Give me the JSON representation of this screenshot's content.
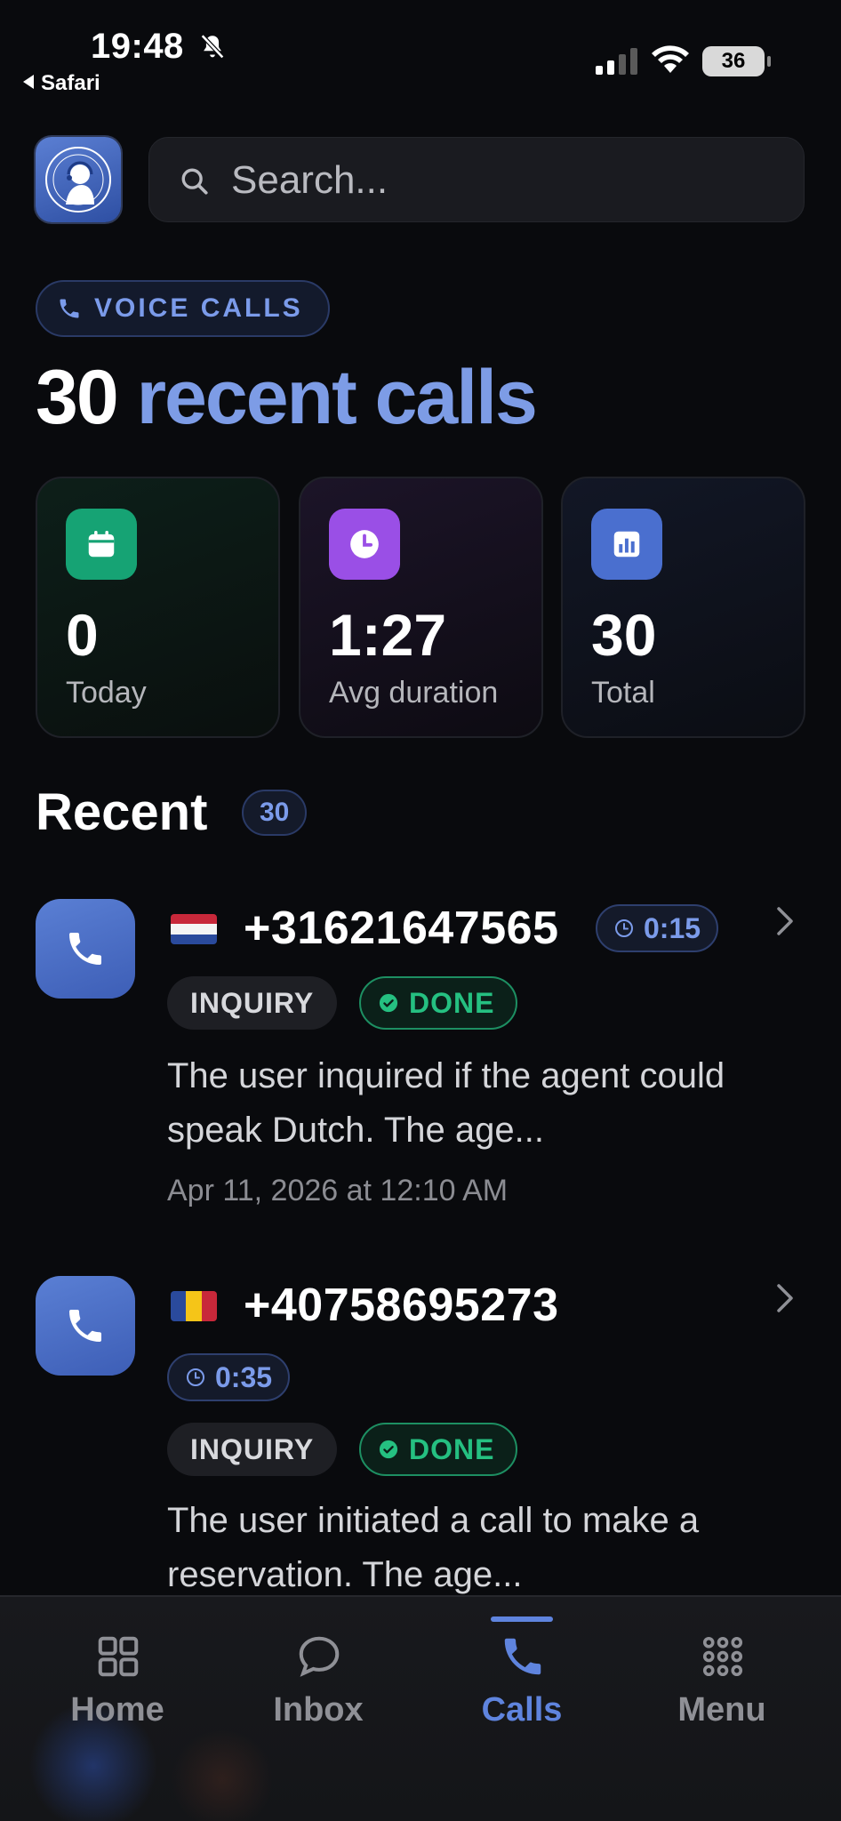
{
  "status_bar": {
    "time": "19:48",
    "back_app": "Safari",
    "battery": "36"
  },
  "search": {
    "placeholder": "Search..."
  },
  "section_pill": "VOICE CALLS",
  "headline": {
    "count": "30",
    "text": "recent calls"
  },
  "stats": [
    {
      "value": "0",
      "label": "Today",
      "icon": "calendar-icon",
      "color": "#16a374"
    },
    {
      "value": "1:27",
      "label": "Avg duration",
      "icon": "clock-icon",
      "color": "#9a4fe6"
    },
    {
      "value": "30",
      "label": "Total",
      "icon": "bar-chart-icon",
      "color": "#4a6fcf"
    }
  ],
  "recent": {
    "title": "Recent",
    "count": "30"
  },
  "calls": [
    {
      "flag": "NL",
      "phone": "+31621647565",
      "duration": "0:15",
      "tag": "INQUIRY",
      "status": "DONE",
      "summary": "The user inquired if the agent could speak Dutch. The age...",
      "date": "Apr 11, 2026 at 12:10 AM"
    },
    {
      "flag": "RO",
      "phone": "+40758695273",
      "duration": "0:35",
      "tag": "INQUIRY",
      "status": "DONE",
      "summary": "The user initiated a call to make a reservation. The age..."
    }
  ],
  "nav": {
    "items": [
      {
        "label": "Home",
        "icon": "grid-icon"
      },
      {
        "label": "Inbox",
        "icon": "chat-bubble-icon"
      },
      {
        "label": "Calls",
        "icon": "phone-icon"
      },
      {
        "label": "Menu",
        "icon": "dots-grid-icon"
      }
    ],
    "active": "Calls",
    "accent": "#5f84de"
  }
}
